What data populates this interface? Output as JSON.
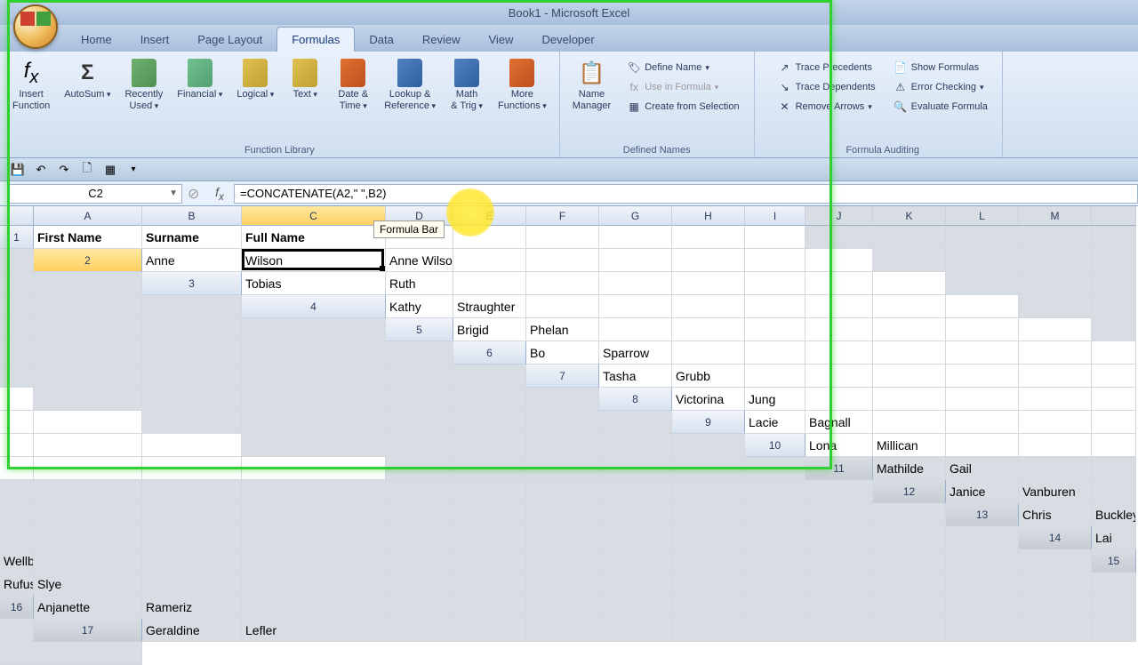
{
  "window": {
    "title": "Book1 - Microsoft Excel"
  },
  "tabs": {
    "home": "Home",
    "insert": "Insert",
    "page_layout": "Page Layout",
    "formulas": "Formulas",
    "data": "Data",
    "review": "Review",
    "view": "View",
    "developer": "Developer"
  },
  "ribbon": {
    "insert_function": "Insert\nFunction",
    "autosum": "AutoSum",
    "recently_used": "Recently\nUsed",
    "financial": "Financial",
    "logical": "Logical",
    "text": "Text",
    "date_time": "Date &\nTime",
    "lookup_ref": "Lookup &\nReference",
    "math_trig": "Math\n& Trig",
    "more_functions": "More\nFunctions",
    "group_function_library": "Function Library",
    "name_manager": "Name\nManager",
    "define_name": "Define Name",
    "use_in_formula": "Use in Formula",
    "create_from_selection": "Create from Selection",
    "group_defined_names": "Defined Names",
    "trace_precedents": "Trace Precedents",
    "trace_dependents": "Trace Dependents",
    "remove_arrows": "Remove Arrows",
    "show_formulas": "Show Formulas",
    "error_checking": "Error Checking",
    "evaluate_formula": "Evaluate Formula",
    "group_formula_auditing": "Formula Auditing"
  },
  "namebox": {
    "cell_ref": "C2"
  },
  "formula_bar": {
    "value": "=CONCATENATE(A2,\" \",B2)"
  },
  "tooltip": {
    "text": "Formula Bar"
  },
  "columns": [
    "A",
    "B",
    "C",
    "D",
    "E",
    "F",
    "G",
    "H",
    "I",
    "J",
    "K",
    "L",
    "M"
  ],
  "rows": [
    {
      "n": 1,
      "a": "First Name",
      "b": "Surname",
      "c": "Full Name"
    },
    {
      "n": 2,
      "a": "Anne",
      "b": "Wilson",
      "c": "Anne Wilson"
    },
    {
      "n": 3,
      "a": "Tobias",
      "b": "Ruth",
      "c": ""
    },
    {
      "n": 4,
      "a": "Kathy",
      "b": "Straughter",
      "c": ""
    },
    {
      "n": 5,
      "a": "Brigid",
      "b": "Phelan",
      "c": ""
    },
    {
      "n": 6,
      "a": "Bo",
      "b": "Sparrow",
      "c": ""
    },
    {
      "n": 7,
      "a": "Tasha",
      "b": "Grubb",
      "c": ""
    },
    {
      "n": 8,
      "a": "Victorina",
      "b": "Jung",
      "c": ""
    },
    {
      "n": 9,
      "a": "Lacie",
      "b": "Bagnall",
      "c": ""
    },
    {
      "n": 10,
      "a": "Lona",
      "b": "Millican",
      "c": ""
    },
    {
      "n": 11,
      "a": "Mathilde",
      "b": "Gail",
      "c": ""
    },
    {
      "n": 12,
      "a": "Janice",
      "b": "Vanburen",
      "c": ""
    },
    {
      "n": 13,
      "a": "Chris",
      "b": "Buckley",
      "c": ""
    },
    {
      "n": 14,
      "a": "Lai",
      "b": "Wellborn",
      "c": ""
    },
    {
      "n": 15,
      "a": "Rufus",
      "b": "Slye",
      "c": ""
    },
    {
      "n": 16,
      "a": "Anjanette",
      "b": "Rameriz",
      "c": ""
    },
    {
      "n": 17,
      "a": "Geraldine",
      "b": "Lefler",
      "c": ""
    }
  ],
  "selected_cell": {
    "row": 2,
    "col": "C"
  },
  "dim_start_row": 11
}
